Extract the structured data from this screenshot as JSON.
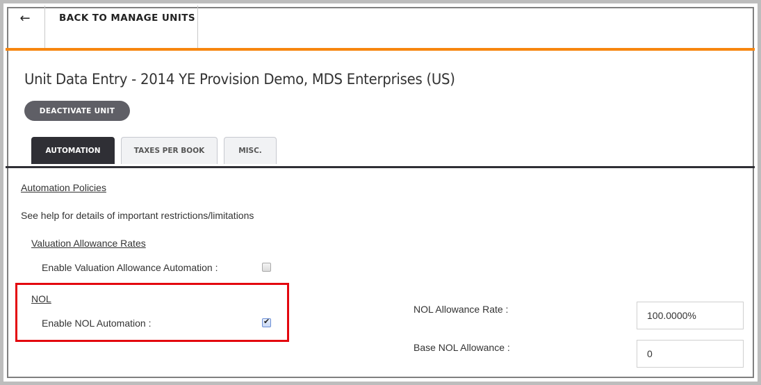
{
  "topbar": {
    "back_icon": "arrow-left-icon",
    "back_arrow_glyph": "←",
    "back_label": "BACK TO MANAGE UNITS"
  },
  "page": {
    "title": "Unit Data Entry - 2014 YE Provision Demo, MDS Enterprises (US)",
    "deactivate_label": "DEACTIVATE UNIT"
  },
  "tabs": [
    {
      "label": "AUTOMATION",
      "active": true
    },
    {
      "label": "TAXES PER BOOK",
      "active": false
    },
    {
      "label": "MISC.",
      "active": false
    }
  ],
  "content": {
    "section_title": "Automation Policies",
    "help_text": "See help for details of important restrictions/limitations",
    "valuation": {
      "heading": "Valuation Allowance Rates",
      "enable_label": "Enable Valuation Allowance Automation :",
      "enabled": false
    },
    "nol": {
      "heading": "NOL",
      "enable_label": "Enable NOL Automation :",
      "enabled": true,
      "check_glyph": "✔",
      "allowance_rate_label": "NOL Allowance Rate :",
      "allowance_rate_value": "100.0000%",
      "base_allowance_label": "Base NOL Allowance :",
      "base_allowance_value": "0"
    }
  },
  "colors": {
    "accent_orange": "#f7860f",
    "tab_active": "#2f2f35",
    "highlight_red": "#e3070e"
  }
}
